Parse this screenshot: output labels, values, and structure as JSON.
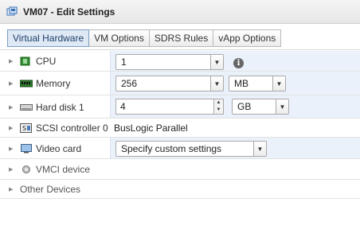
{
  "window": {
    "title": "VM07 - Edit Settings",
    "icon": "vm-icon"
  },
  "tabs": [
    {
      "label": "Virtual Hardware",
      "active": true
    },
    {
      "label": "VM Options",
      "active": false
    },
    {
      "label": "SDRS Rules",
      "active": false
    },
    {
      "label": "vApp Options",
      "active": false
    }
  ],
  "hardware": {
    "cpu": {
      "label": "CPU",
      "icon": "cpu-icon",
      "value": "1"
    },
    "memory": {
      "label": "Memory",
      "icon": "memory-icon",
      "value": "256",
      "unit": "MB"
    },
    "hard_disk": {
      "label": "Hard disk 1",
      "icon": "hard-disk-icon",
      "value": "4",
      "unit": "GB"
    },
    "scsi": {
      "label": "SCSI controller 0",
      "icon": "scsi-controller-icon",
      "value": "BusLogic Parallel"
    },
    "video": {
      "label": "Video card",
      "icon": "video-card-icon",
      "value": "Specify custom settings"
    },
    "vmci": {
      "label": "VMCI device",
      "icon": "vmci-device-icon"
    },
    "other": {
      "label": "Other Devices"
    }
  },
  "colors": {
    "selected_tab": "#dfe9f5",
    "value_column": "#eaf1fa"
  }
}
